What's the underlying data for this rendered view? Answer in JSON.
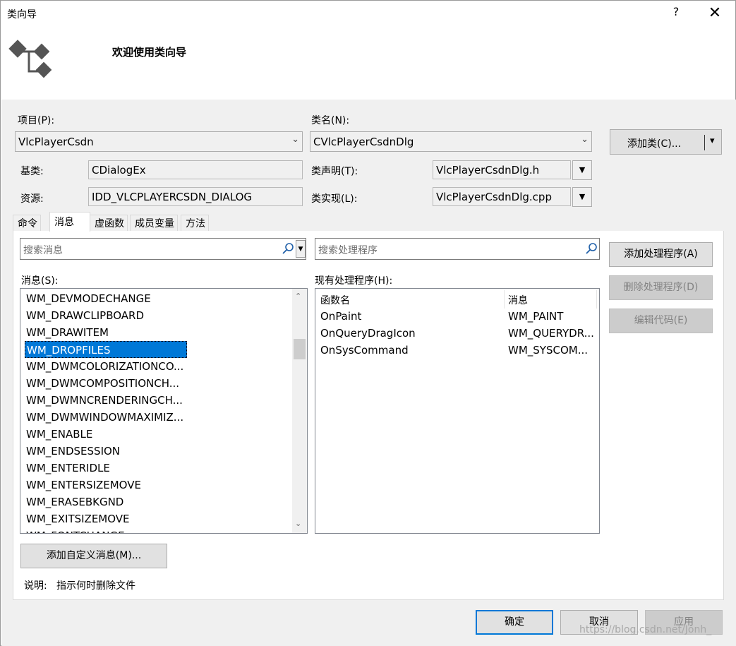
{
  "window": {
    "title": "类向导",
    "help_label": "?",
    "close_label": "✕",
    "header_title": "欢迎使用类向导"
  },
  "project": {
    "label": "项目(P):",
    "value": "VlcPlayerCsdn"
  },
  "classname": {
    "label": "类名(N):",
    "value": "CVlcPlayerCsdnDlg"
  },
  "add_class": {
    "label": "添加类(C)...",
    "arrow": "▾"
  },
  "base_class": {
    "label": "基类:",
    "value": "CDialogEx"
  },
  "resource": {
    "label": "资源:",
    "value": "IDD_VLCPLAYERCSDN_DIALOG"
  },
  "class_decl": {
    "label": "类声明(T):",
    "value": "VlcPlayerCsdnDlg.h"
  },
  "class_impl": {
    "label": "类实现(L):",
    "value": "VlcPlayerCsdnDlg.cpp"
  },
  "tabs": [
    {
      "label": "命令"
    },
    {
      "label": "消息"
    },
    {
      "label": "虚函数"
    },
    {
      "label": "成员变量"
    },
    {
      "label": "方法"
    }
  ],
  "search_messages": {
    "placeholder": "搜索消息"
  },
  "search_handlers": {
    "placeholder": "搜索处理程序"
  },
  "messages": {
    "label": "消息(S):",
    "items": [
      "WM_DEVMODECHANGE",
      "WM_DRAWCLIPBOARD",
      "WM_DRAWITEM",
      "WM_DROPFILES",
      "WM_DWMCOLORIZATIONCO...",
      "WM_DWMCOMPOSITIONCH...",
      "WM_DWMNCRENDERINGCH...",
      "WM_DWMWINDOWMAXIMIZ...",
      "WM_ENABLE",
      "WM_ENDSESSION",
      "WM_ENTERIDLE",
      "WM_ENTERSIZEMOVE",
      "WM_ERASEBKGND",
      "WM_EXITSIZEMOVE",
      "WM_FONTCHANGE"
    ],
    "selected": "WM_DROPFILES"
  },
  "handlers": {
    "label": "现有处理程序(H):",
    "col_function": "函数名",
    "col_message": "消息",
    "rows": [
      {
        "function": "OnPaint",
        "message": "WM_PAINT"
      },
      {
        "function": "OnQueryDragIcon",
        "message": "WM_QUERYDR..."
      },
      {
        "function": "OnSysCommand",
        "message": "WM_SYSCOM..."
      }
    ]
  },
  "buttons": {
    "add_handler": "添加处理程序(A)",
    "delete_handler": "删除处理程序(D)",
    "edit_code": "编辑代码(E)",
    "add_custom_message": "添加自定义消息(M)...",
    "ok": "确定",
    "cancel": "取消",
    "apply": "应用"
  },
  "description": {
    "label": "说明:",
    "value": "指示何时删除文件"
  },
  "watermark": "https://blog.csdn.net/Jonh_",
  "colors": {
    "selection": "#0078d7",
    "dialog_bg": "#f0f0f0"
  }
}
